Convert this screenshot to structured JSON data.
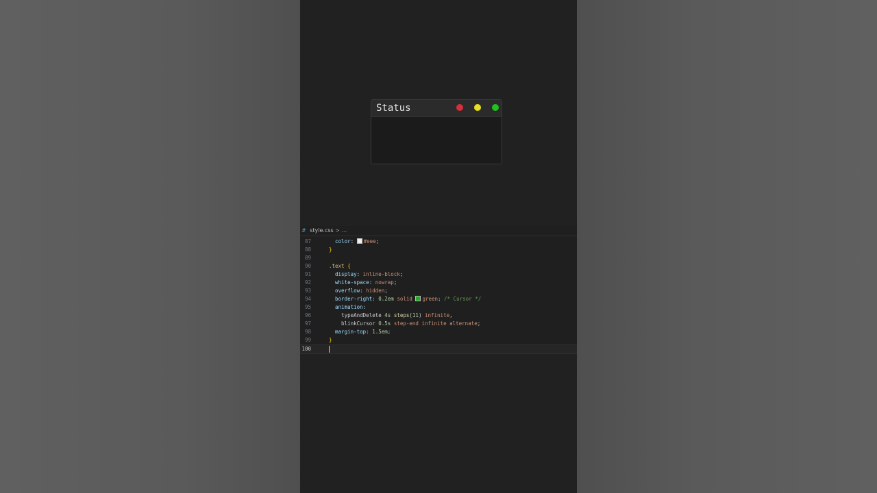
{
  "preview": {
    "title": "Status",
    "window_colors": {
      "red": "#d62f3a",
      "yellow": "#e6e021",
      "green": "#22c11f"
    }
  },
  "editor": {
    "breadcrumb": {
      "icon": "#",
      "file": "style.css",
      "separator": ">",
      "rest": "..."
    },
    "current_line": "100",
    "lines": [
      {
        "n": "87",
        "parts": [
          [
            "prop",
            "  color"
          ],
          [
            "plain",
            ": "
          ],
          [
            "swatch",
            "#eeeeee"
          ],
          [
            "val",
            "#eee"
          ],
          [
            "plain",
            ";"
          ]
        ]
      },
      {
        "n": "88",
        "parts": [
          [
            "brace",
            "}"
          ]
        ]
      },
      {
        "n": "89",
        "parts": []
      },
      {
        "n": "90",
        "parts": [
          [
            "sel",
            ".text"
          ],
          [
            "plain",
            " "
          ],
          [
            "brace",
            "{"
          ]
        ]
      },
      {
        "n": "91",
        "parts": [
          [
            "prop",
            "  display"
          ],
          [
            "plain",
            ": "
          ],
          [
            "val",
            "inline-block"
          ],
          [
            "plain",
            ";"
          ]
        ]
      },
      {
        "n": "92",
        "parts": [
          [
            "prop",
            "  white-space"
          ],
          [
            "plain",
            ": "
          ],
          [
            "val",
            "nowrap"
          ],
          [
            "plain",
            ";"
          ]
        ]
      },
      {
        "n": "93",
        "parts": [
          [
            "prop",
            "  overflow"
          ],
          [
            "plain",
            ": "
          ],
          [
            "val",
            "hidden"
          ],
          [
            "plain",
            ";"
          ]
        ]
      },
      {
        "n": "94",
        "parts": [
          [
            "prop",
            "  border-right"
          ],
          [
            "plain",
            ": "
          ],
          [
            "num",
            "0.2em"
          ],
          [
            "plain",
            " "
          ],
          [
            "val",
            "solid"
          ],
          [
            "plain",
            " "
          ],
          [
            "swatch",
            "#1fae1f"
          ],
          [
            "val",
            "green"
          ],
          [
            "plain",
            "; "
          ],
          [
            "cm",
            "/* Cursor */"
          ]
        ]
      },
      {
        "n": "95",
        "parts": [
          [
            "prop",
            "  animation"
          ],
          [
            "plain",
            ":"
          ]
        ]
      },
      {
        "n": "96",
        "parts": [
          [
            "plain",
            "    typeAndDelete "
          ],
          [
            "num",
            "4s"
          ],
          [
            "plain",
            " "
          ],
          [
            "kw",
            "steps"
          ],
          [
            "plain",
            "("
          ],
          [
            "num",
            "11"
          ],
          [
            "plain",
            ") "
          ],
          [
            "val",
            "infinite"
          ],
          [
            "plain",
            ","
          ]
        ]
      },
      {
        "n": "97",
        "parts": [
          [
            "plain",
            "    blinkCursor "
          ],
          [
            "num",
            "0.5s"
          ],
          [
            "plain",
            " "
          ],
          [
            "val",
            "step-end"
          ],
          [
            "plain",
            " "
          ],
          [
            "val",
            "infinite"
          ],
          [
            "plain",
            " "
          ],
          [
            "val",
            "alternate"
          ],
          [
            "plain",
            ";"
          ]
        ]
      },
      {
        "n": "98",
        "parts": [
          [
            "prop",
            "  margin-top"
          ],
          [
            "plain",
            ": "
          ],
          [
            "num",
            "1.5em"
          ],
          [
            "plain",
            ";"
          ]
        ]
      },
      {
        "n": "99",
        "parts": [
          [
            "brace",
            "}"
          ]
        ]
      },
      {
        "n": "100",
        "parts": []
      }
    ]
  }
}
